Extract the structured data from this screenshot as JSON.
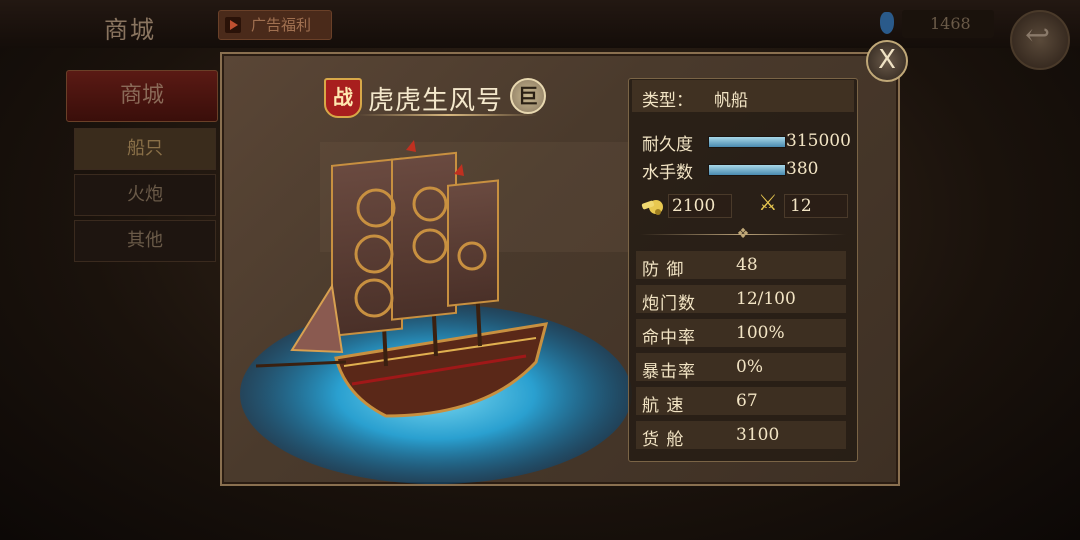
{
  "topbar": {
    "title": "商城",
    "ad_label": "广告福利",
    "gold": "1468"
  },
  "sidebar": {
    "header": "商城",
    "items": [
      {
        "label": "船只",
        "active": true
      },
      {
        "label": "火炮",
        "active": false
      },
      {
        "label": "其他",
        "active": false
      }
    ]
  },
  "dialog": {
    "close_label": "X",
    "badge": "战",
    "ship_name": "虎虎生风号",
    "size_badge": "巨",
    "type_label": "类型：",
    "type_value": "帆船",
    "durability_label": "耐久度",
    "durability_value": "315000",
    "durability_fill": 1.0,
    "sailors_label": "水手数",
    "sailors_value": "380",
    "sailors_fill": 1.0,
    "cannon_power": "2100",
    "melee_power": "12",
    "stats": [
      {
        "label": "防 御",
        "value": "48"
      },
      {
        "label": "炮门数",
        "value": "12/100"
      },
      {
        "label": "命中率",
        "value": "100%"
      },
      {
        "label": "暴击率",
        "value": "0%"
      },
      {
        "label": "航 速",
        "value": "67"
      },
      {
        "label": "货 舱",
        "value": "3100"
      }
    ]
  },
  "colors": {
    "accent_gold": "#d8b880",
    "badge_red": "#a81e1e",
    "bar_blue": "#4a8ab0"
  }
}
